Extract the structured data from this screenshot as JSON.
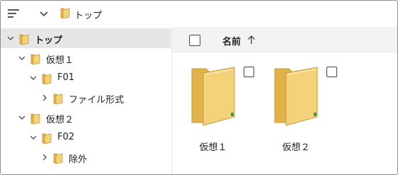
{
  "toolbar": {
    "menu_icon": "hamburger-menu-icon",
    "chevron_icon": "chevron-down-icon",
    "breadcrumb": {
      "folder_icon": "folder-icon",
      "label": "トップ"
    }
  },
  "tree": {
    "items": [
      {
        "label": "トップ",
        "expanded": true,
        "selected": true,
        "depth": 0
      },
      {
        "label": "仮想１",
        "expanded": true,
        "selected": false,
        "depth": 1
      },
      {
        "label": "F01",
        "expanded": true,
        "selected": false,
        "depth": 2
      },
      {
        "label": "ファイル形式",
        "expanded": false,
        "selected": false,
        "depth": 3
      },
      {
        "label": "仮想２",
        "expanded": true,
        "selected": false,
        "depth": 1
      },
      {
        "label": "F02",
        "expanded": true,
        "selected": false,
        "depth": 2
      },
      {
        "label": "除外",
        "expanded": false,
        "selected": false,
        "depth": 3
      }
    ]
  },
  "content": {
    "header": {
      "name_label": "名前",
      "sort_icon": "sort-ascending-arrow-icon"
    },
    "folders": [
      {
        "label": "仮想１",
        "icon": "folder-large-icon"
      },
      {
        "label": "仮想２",
        "icon": "folder-large-icon"
      }
    ]
  },
  "colors": {
    "folder_front": "#f3d27a",
    "folder_back": "#e0b24a",
    "folder_outline": "#c9983a",
    "selection": "#e6e6e6",
    "header_bg": "#f3f3f3",
    "badge_green": "#2e9e4f"
  }
}
